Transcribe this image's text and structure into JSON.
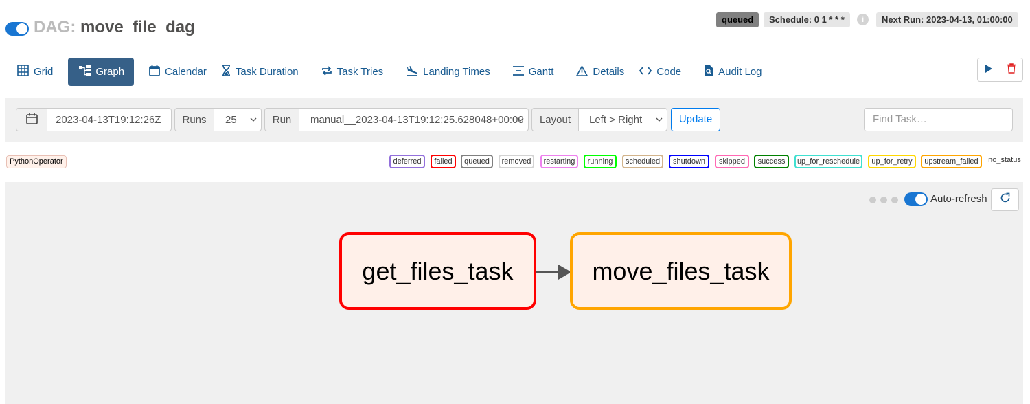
{
  "header": {
    "dag_prefix": "DAG:",
    "dag_name": "move_file_dag",
    "status_badge": "queued",
    "schedule": "Schedule: 0 1 * * *",
    "info_glyph": "i",
    "next_run": "Next Run: 2023-04-13, 01:00:00",
    "dag_active": true
  },
  "nav": {
    "tabs": [
      {
        "label": "Grid",
        "icon": "grid-icon"
      },
      {
        "label": "Graph",
        "icon": "graph-icon",
        "active": true
      },
      {
        "label": "Calendar",
        "icon": "calendar-icon"
      },
      {
        "label": "Task Duration",
        "icon": "hourglass-icon"
      },
      {
        "label": "Task Tries",
        "icon": "repeat-icon"
      },
      {
        "label": "Landing Times",
        "icon": "plane-landing-icon"
      },
      {
        "label": "Gantt",
        "icon": "gantt-icon"
      },
      {
        "label": "Details",
        "icon": "warning-triangle-icon"
      },
      {
        "label": "Code",
        "icon": "code-icon"
      },
      {
        "label": "Audit Log",
        "icon": "document-search-icon"
      }
    ],
    "actions": [
      "play-icon",
      "trash-icon"
    ]
  },
  "filters": {
    "base_date": "2023-04-13T19:12:26Z",
    "runs_label": "Runs",
    "runs_value": "25",
    "run_label": "Run",
    "run_value": "manual__2023-04-13T19:12:25.628048+00:00",
    "layout_label": "Layout",
    "layout_value": "Left > Right",
    "update_label": "Update",
    "find_placeholder": "Find Task…"
  },
  "legend": {
    "operator": "PythonOperator",
    "operator_color": "#fff1ea",
    "states": [
      {
        "label": "deferred",
        "color": "#9370db"
      },
      {
        "label": "failed",
        "color": "#ff0000"
      },
      {
        "label": "queued",
        "color": "#808080"
      },
      {
        "label": "removed",
        "color": "#d3d3d3"
      },
      {
        "label": "restarting",
        "color": "#ee82ee"
      },
      {
        "label": "running",
        "color": "#00ff00"
      },
      {
        "label": "scheduled",
        "color": "#d2b48c"
      },
      {
        "label": "shutdown",
        "color": "#0000ff"
      },
      {
        "label": "skipped",
        "color": "#ff69b4"
      },
      {
        "label": "success",
        "color": "#008000"
      },
      {
        "label": "up_for_reschedule",
        "color": "#40e0d0"
      },
      {
        "label": "up_for_retry",
        "color": "#ffd700"
      },
      {
        "label": "upstream_failed",
        "color": "#ffa500"
      },
      {
        "label": "no_status",
        "color": ""
      }
    ]
  },
  "graph": {
    "auto_refresh_label": "Auto-refresh",
    "auto_refresh_on": true,
    "nodes": [
      {
        "label": "get_files_task",
        "state": "failed",
        "border": "#ff0000"
      },
      {
        "label": "move_files_task",
        "state": "upstream_failed",
        "border": "#ffa500"
      }
    ],
    "edges": [
      [
        "get_files_task",
        "move_files_task"
      ]
    ]
  },
  "colors": {
    "accent": "#017cee",
    "nav_active_bg": "#366088",
    "toggle_on": "#1976d2",
    "node_fill": "#fff0e9"
  }
}
